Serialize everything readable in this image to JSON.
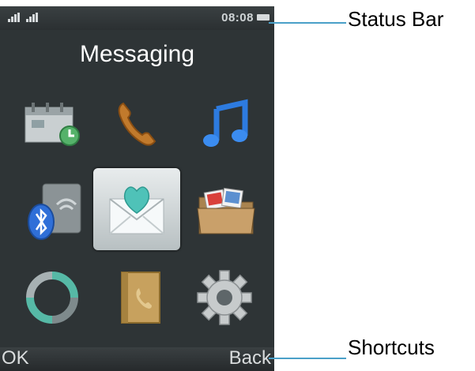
{
  "status_bar": {
    "time": "08:08"
  },
  "screen": {
    "title": "Messaging",
    "icons": [
      {
        "name": "calendar-icon"
      },
      {
        "name": "phone-call-icon"
      },
      {
        "name": "music-note-icon"
      },
      {
        "name": "bluetooth-icon"
      },
      {
        "name": "message-envelope-icon",
        "selected": true
      },
      {
        "name": "photo-folder-icon"
      },
      {
        "name": "sync-icon"
      },
      {
        "name": "contacts-book-icon"
      },
      {
        "name": "settings-gear-icon"
      }
    ]
  },
  "softkeys": {
    "left": "OK",
    "right": "Back"
  },
  "callouts": {
    "status_bar": "Status Bar",
    "shortcuts": "Shortcuts"
  },
  "colors": {
    "screen_bg": "#2e3436",
    "callout_line": "#4aa0c8"
  }
}
